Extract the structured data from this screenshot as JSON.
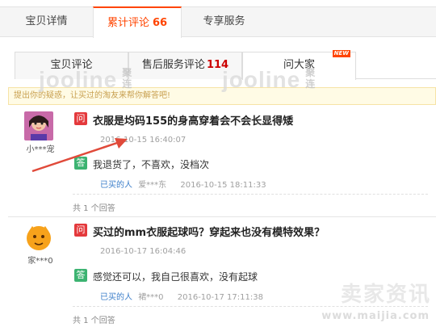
{
  "top_tabs": [
    {
      "label": "宝贝详情",
      "count": ""
    },
    {
      "label": "累计评论",
      "count": "66"
    },
    {
      "label": "专享服务",
      "count": ""
    }
  ],
  "sub_tabs": [
    {
      "label": "宝贝评论",
      "count": ""
    },
    {
      "label": "售后服务评论",
      "count": "114"
    },
    {
      "label": "问大家",
      "badge": "NEW"
    }
  ],
  "notice": "提出你的疑惑，让买过的淘友来帮你解答吧!",
  "watermark": {
    "text": "jooline",
    "cn": "聚连"
  },
  "questions": [
    {
      "user": "小***宠",
      "question": "衣服是均码155的身高穿着会不会长显得矮",
      "q_time": "2016-10-15 16:40:07",
      "answer": "我退货了，不喜欢，没档次",
      "bought_label": "已买的人",
      "answerer": "爱***东",
      "a_time": "2016-10-15 18:11:33",
      "answer_count": "共 1 个回答"
    },
    {
      "user": "家***0",
      "question": "买过的mm衣服起球吗？穿起来也没有模特效果？",
      "q_time": "2016-10-17 16:04:46",
      "answer": "感觉还可以，我自己很喜欢，没有起球",
      "bought_label": "已买的人",
      "answerer": "裙***0",
      "a_time": "2016-10-17 17:11:38",
      "answer_count": "共 1 个回答"
    }
  ],
  "q_icon": "问",
  "a_icon": "答",
  "brand": {
    "name": "卖家资讯",
    "url": "www.maijia.com"
  },
  "colors": {
    "accent": "#ff4400",
    "question_icon": "#e4393c",
    "answer_icon": "#3cb371",
    "link": "#3a7dc9",
    "arrow": "#e04a3a"
  }
}
